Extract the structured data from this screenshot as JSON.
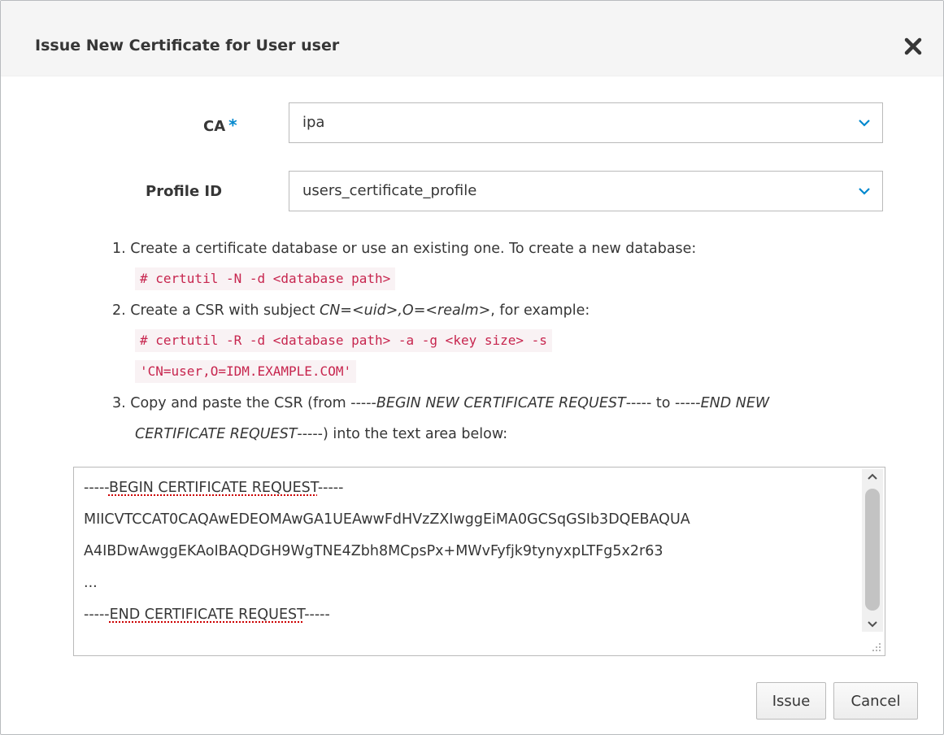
{
  "dialog": {
    "title": "Issue New Certificate for User user"
  },
  "fields": {
    "ca": {
      "label": "CA",
      "required_mark": "*",
      "value": "ipa"
    },
    "profile": {
      "label": "Profile ID",
      "value": "users_certificate_profile"
    }
  },
  "instructions": {
    "step1": "1. Create a certificate database or use an existing one. To create a new database:",
    "step1_code": "# certutil -N -d <database path>",
    "step2_a": "2. Create a CSR with subject ",
    "step2_em": "CN=<uid>,O=<realm>",
    "step2_b": ", for example:",
    "step2_code_1": "# certutil -R -d <database path> -a -g <key size> -s",
    "step2_code_2": "'CN=user,O=IDM.EXAMPLE.COM'",
    "step3_a": "3. Copy and paste the CSR (from -----",
    "step3_em1": "BEGIN NEW CERTIFICATE REQUEST",
    "step3_b": "----- to -----",
    "step3_em2a": "END NEW",
    "step3_em2b": "CERTIFICATE REQUEST",
    "step3_c": "-----) into the text area below:"
  },
  "csr": {
    "begin_dashes": "-----",
    "begin_text": "BEGIN CERTIFICATE REQUEST",
    "begin_tail": "-----",
    "line1": "MIICVTCCAT0CAQAwEDEOMAwGA1UEAwwFdHVzZXIwggEiMA0GCSqGSIb3DQEBAQUA",
    "line2": "A4IBDwAwggEKAoIBAQDGH9WgTNE4Zbh8MCpsPx+MWvFyfjk9tynyxpLTFg5x2r63",
    "ellipsis": "...",
    "end_dashes": "-----",
    "end_text": "END CERTIFICATE REQUEST",
    "end_tail": "-----"
  },
  "buttons": {
    "issue": "Issue",
    "cancel": "Cancel"
  },
  "icons": {
    "close": "close-icon",
    "dropdown": "chevron-down-icon",
    "accent_color": "#0088ce"
  }
}
